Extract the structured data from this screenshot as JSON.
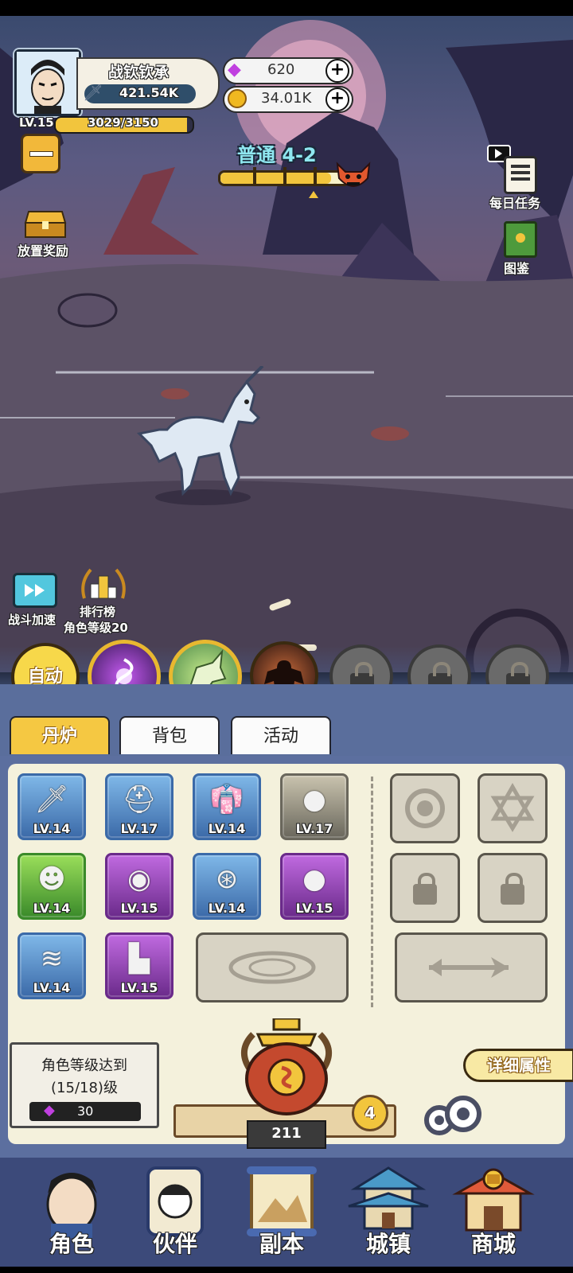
{
  "player": {
    "name": "战钦钦承",
    "power": "421.54K",
    "level": "LV.15",
    "exp": "3029/3150",
    "exp_fraction": 0.96
  },
  "currency": {
    "gems": "620",
    "gold": "34.01K"
  },
  "stage": {
    "label": "普通 4-2",
    "progress_fraction": 0.87
  },
  "left_menu": {
    "idle_reward": "放置奖励",
    "battle_speed": "战斗加速",
    "ranking": "排行榜",
    "role_level": "角色等级20"
  },
  "right_menu": {
    "daily_tasks": "每日任务",
    "codex": "图鉴"
  },
  "skills": {
    "auto": "自动"
  },
  "tabs": [
    "丹炉",
    "背包",
    "活动"
  ],
  "equipment": [
    {
      "level": "LV.14",
      "frame": "blue",
      "icon": "sword-icon"
    },
    {
      "level": "LV.17",
      "frame": "blue",
      "icon": "helmet-icon"
    },
    {
      "level": "LV.14",
      "frame": "blue",
      "icon": "robe-icon"
    },
    {
      "level": "LV.17",
      "frame": "grey",
      "icon": "skull-coin-icon"
    },
    {
      "level": "LV.14",
      "frame": "green",
      "icon": "monster-pet-icon"
    },
    {
      "level": "LV.15",
      "frame": "purple",
      "icon": "swirl-orb-icon"
    },
    {
      "level": "LV.14",
      "frame": "blue",
      "icon": "amulet-icon"
    },
    {
      "level": "LV.15",
      "frame": "purple",
      "icon": "fire-orb-icon"
    },
    {
      "level": "LV.14",
      "frame": "blue",
      "icon": "belt-icon"
    },
    {
      "level": "LV.15",
      "frame": "purple",
      "icon": "boots-icon"
    }
  ],
  "unlock_panel": {
    "line1": "角色等级达到",
    "line2": "(15/18)级",
    "gem_cost": "30"
  },
  "furnace": {
    "count": "211",
    "level_badge": "4"
  },
  "details_button": "详细属性",
  "bottom_nav": [
    "角色",
    "伙伴",
    "副本",
    "城镇",
    "商城"
  ],
  "colors": {
    "gem": "#c040e0",
    "gold": "#f0b820",
    "active_tab": "#f5c842",
    "panel_bg": "#f4f1dc",
    "nav_bg": "#3c4a7a"
  }
}
